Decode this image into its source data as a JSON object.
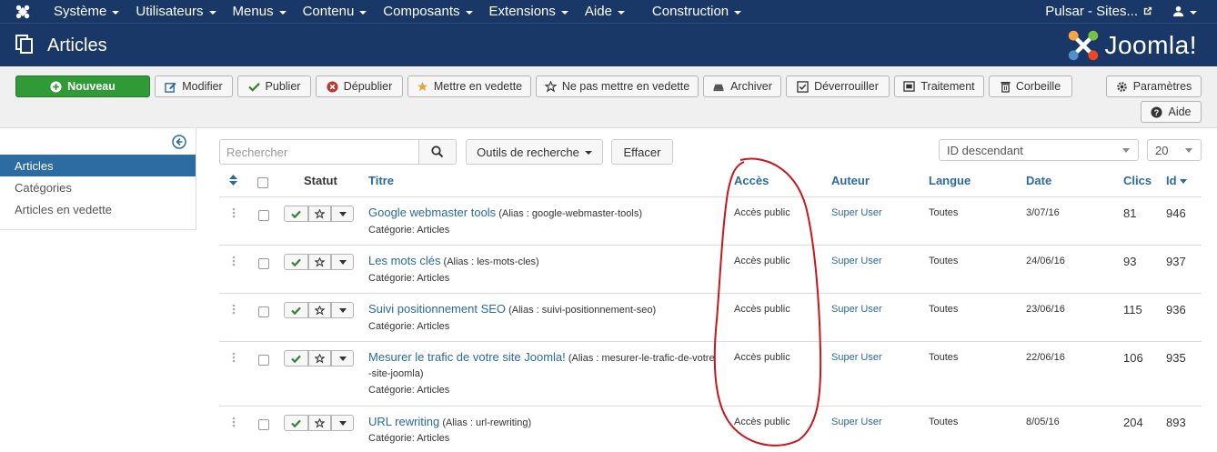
{
  "nav": {
    "items": [
      "Système",
      "Utilisateurs",
      "Menus",
      "Contenu",
      "Composants",
      "Extensions",
      "Aide",
      "Construction"
    ],
    "site": "Pulsar - Sites..."
  },
  "header": {
    "title": "Articles",
    "logo_text": "Joomla!"
  },
  "toolbar": {
    "new": "Nouveau",
    "edit": "Modifier",
    "publish": "Publier",
    "unpublish": "Dépublier",
    "feature": "Mettre en vedette",
    "unfeature": "Ne pas mettre en vedette",
    "archive": "Archiver",
    "checkin": "Déverrouiller",
    "batch": "Traitement",
    "trash": "Corbeille",
    "options": "Paramètres",
    "help": "Aide"
  },
  "sidebar": {
    "items": [
      "Articles",
      "Catégories",
      "Articles en vedette"
    ],
    "active": 0
  },
  "filters": {
    "search_placeholder": "Rechercher",
    "search_tools": "Outils de recherche",
    "clear": "Effacer",
    "ordering": "ID descendant",
    "limit": "20"
  },
  "table": {
    "headers": {
      "status": "Statut",
      "title": "Titre",
      "access": "Accès",
      "author": "Auteur",
      "language": "Langue",
      "date": "Date",
      "hits": "Clics",
      "id": "Id"
    },
    "rows": [
      {
        "title": "Google webmaster tools",
        "alias": "(Alias : google-webmaster-tools)",
        "alias2": "",
        "category": "Catégorie: Articles",
        "access": "Accès public",
        "author": "Super User",
        "language": "Toutes",
        "date": "3/07/16",
        "hits": "81",
        "id": "946"
      },
      {
        "title": "Les mots clés",
        "alias": "(Alias : les-mots-cles)",
        "alias2": "",
        "category": "Catégorie: Articles",
        "access": "Accès public",
        "author": "Super User",
        "language": "Toutes",
        "date": "24/06/16",
        "hits": "93",
        "id": "937"
      },
      {
        "title": "Suivi positionnement SEO",
        "alias": "(Alias : suivi-positionnement-seo)",
        "alias2": "",
        "category": "Catégorie: Articles",
        "access": "Accès public",
        "author": "Super User",
        "language": "Toutes",
        "date": "23/06/16",
        "hits": "115",
        "id": "936"
      },
      {
        "title": "Mesurer le trafic de votre site Joomla!",
        "alias": "(Alias : mesurer-le-trafic-de-votre",
        "alias2": "-site-joomla)",
        "category": "Catégorie: Articles",
        "access": "Accès public",
        "author": "Super User",
        "language": "Toutes",
        "date": "22/06/16",
        "hits": "106",
        "id": "935"
      },
      {
        "title": "URL rewriting",
        "alias": "(Alias : url-rewriting)",
        "alias2": "",
        "category": "Catégorie: Articles",
        "access": "Accès public",
        "author": "Super User",
        "language": "Toutes",
        "date": "8/05/16",
        "hits": "204",
        "id": "893"
      }
    ]
  },
  "colors": {
    "navbar": "#1a3867",
    "accent": "#2b6aa0",
    "green": "#2f9a36",
    "annotation": "#c8161d"
  }
}
